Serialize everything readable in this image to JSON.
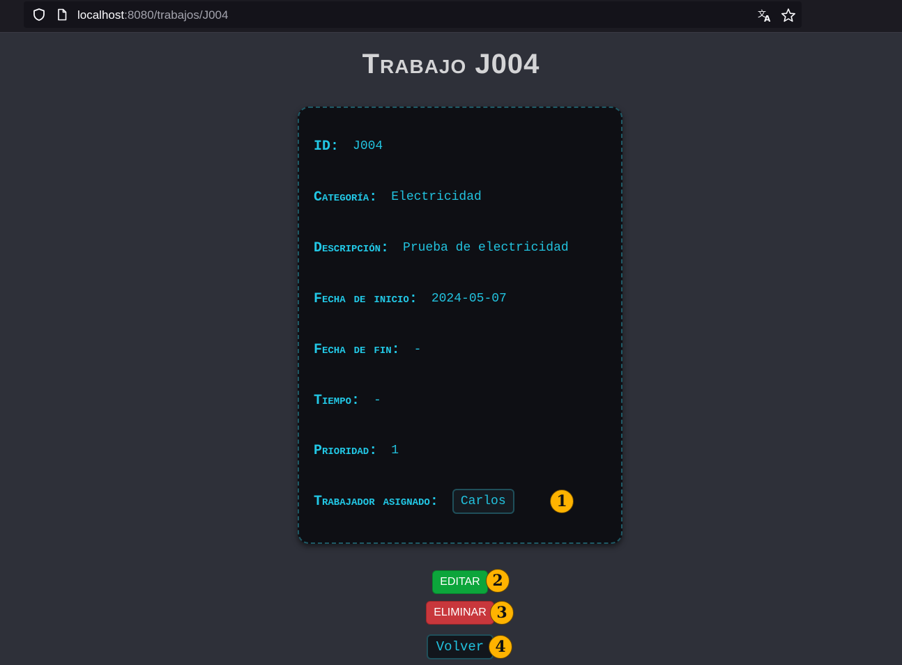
{
  "browser": {
    "url_host": "localhost",
    "url_rest": ":8080/trabajos/J004"
  },
  "page": {
    "title": "Trabajo J004"
  },
  "job": {
    "id_label": "ID:",
    "id_value": "J004",
    "category_label": "Categoría:",
    "category_value": "Electricidad",
    "description_label": "Descripción:",
    "description_value": "Prueba de electricidad",
    "start_label": "Fecha de inicio:",
    "start_value": "2024-05-07",
    "end_label": "Fecha de fin:",
    "end_value": "-",
    "time_label": "Tiempo:",
    "time_value": "-",
    "priority_label": "Prioridad:",
    "priority_value": "1",
    "worker_label": "Trabajador asignado:",
    "worker_value": "Carlos"
  },
  "actions": {
    "edit_label": "EDITAR",
    "delete_label": "ELIMINAR",
    "back_label": "Volver"
  },
  "badges": [
    "1",
    "2",
    "3",
    "4"
  ],
  "colors": {
    "background": "#2e3039",
    "card": "#0e0f14",
    "accent": "#22c2de",
    "edit": "#0ca53b",
    "delete": "#c8373c",
    "badge": "#ffb300"
  }
}
